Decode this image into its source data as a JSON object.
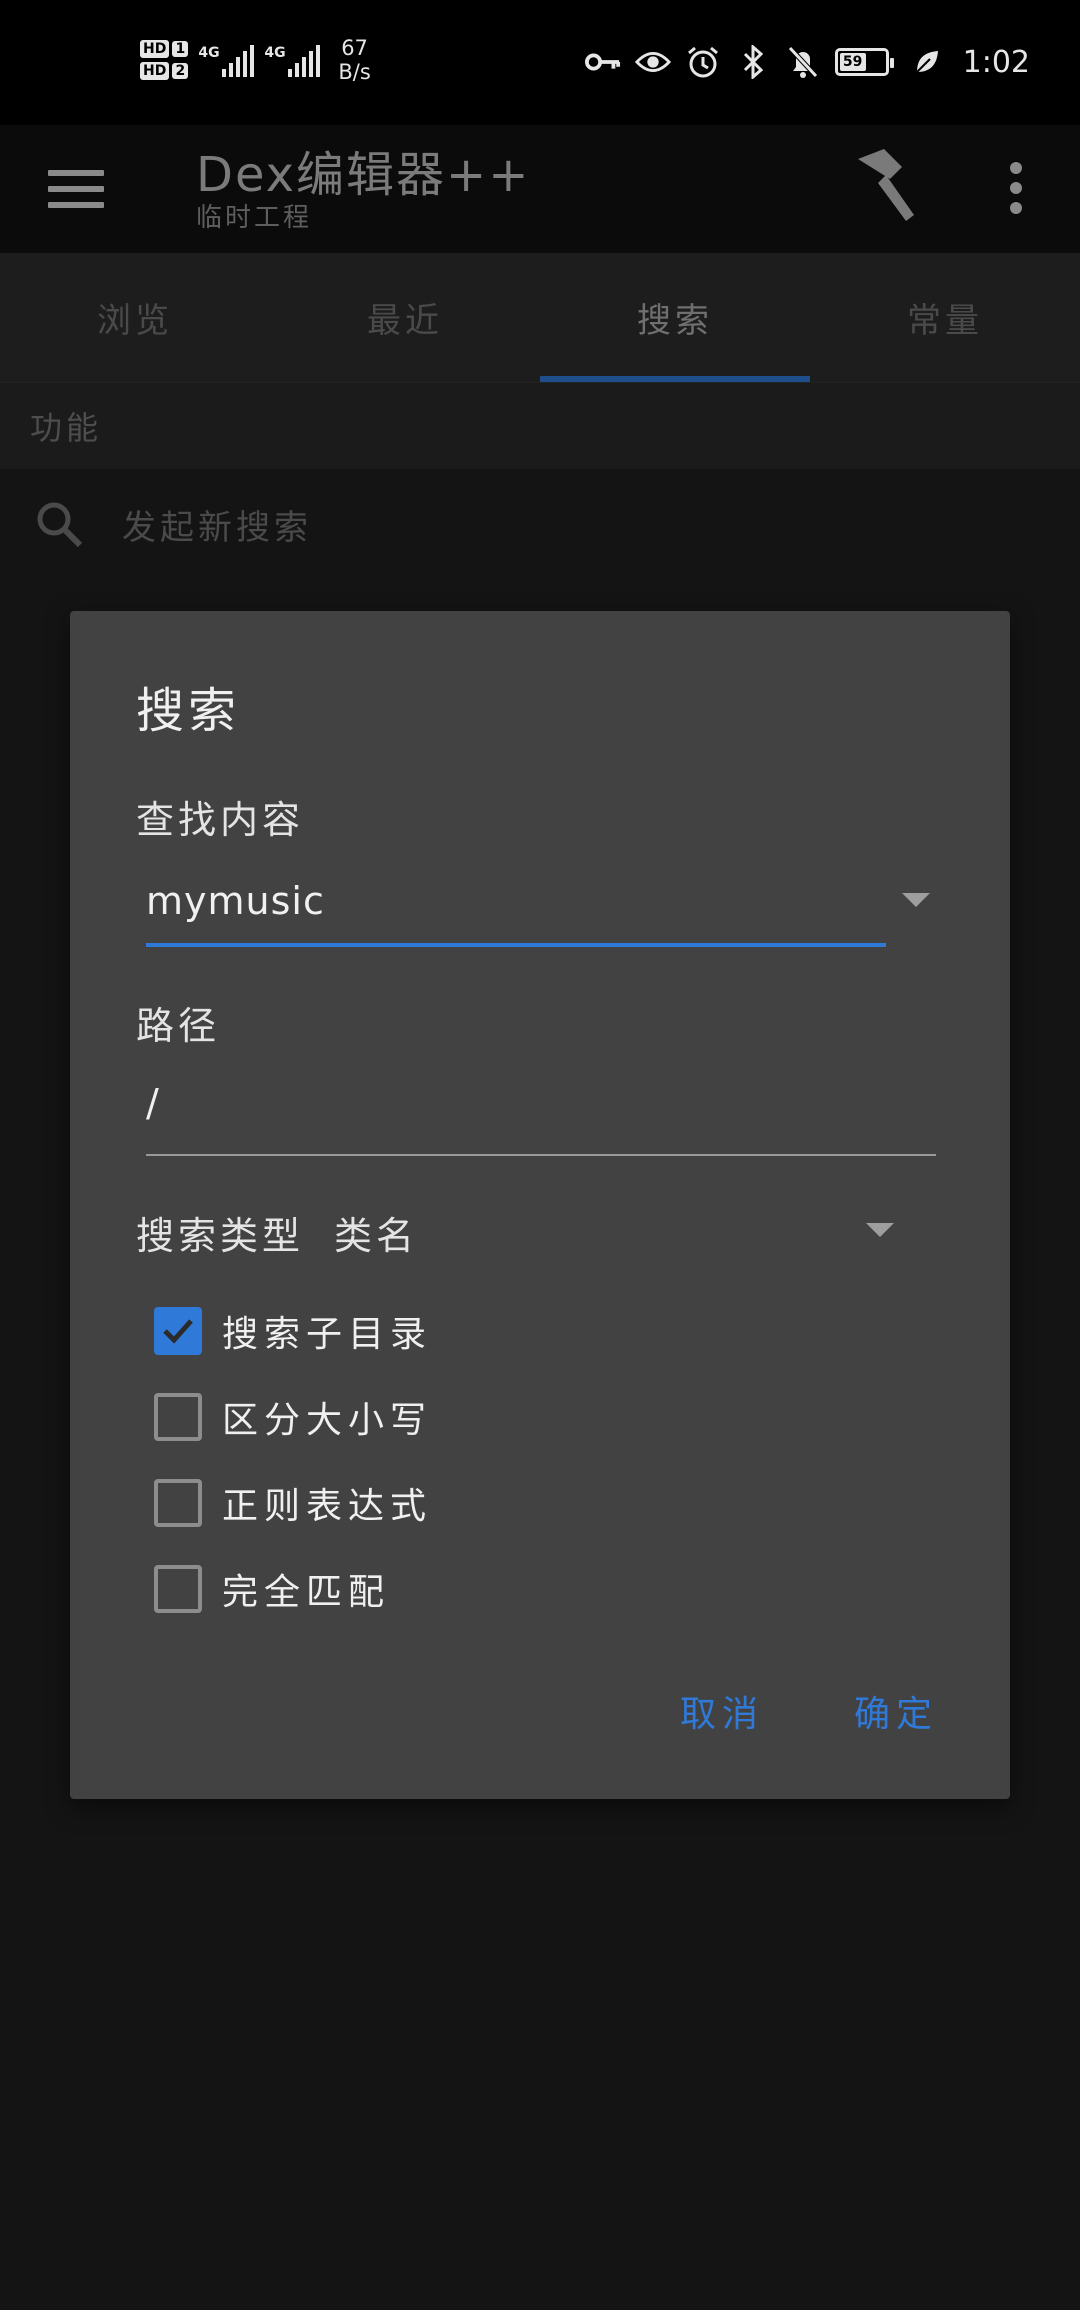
{
  "status_bar": {
    "hd1": "HD",
    "hd1_num": "1",
    "hd2": "HD",
    "hd2_num": "2",
    "net1": "4G",
    "net2": "4G",
    "speed_value": "67",
    "speed_unit": "B/s",
    "battery_level": "59",
    "time": "1:02",
    "icons": [
      "key-icon",
      "eye-icon",
      "alarm-icon",
      "bluetooth-icon",
      "bell-off-icon",
      "battery-icon",
      "leaf-icon"
    ]
  },
  "app_bar": {
    "title": "Dex编辑器++",
    "subtitle": "临时工程"
  },
  "tabs": [
    {
      "label": "浏览",
      "active": false
    },
    {
      "label": "最近",
      "active": false
    },
    {
      "label": "搜索",
      "active": true
    },
    {
      "label": "常量",
      "active": false
    }
  ],
  "section": {
    "header": "功能",
    "new_search": "发起新搜索"
  },
  "dialog": {
    "title": "搜索",
    "find_label": "查找内容",
    "find_value": "mymusic",
    "path_label": "路径",
    "path_value": "/",
    "search_type_label": "搜索类型",
    "search_type_value": "类名",
    "options": [
      {
        "label": "搜索子目录",
        "checked": true
      },
      {
        "label": "区分大小写",
        "checked": false
      },
      {
        "label": "正则表达式",
        "checked": false
      },
      {
        "label": "完全匹配",
        "checked": false
      }
    ],
    "cancel": "取消",
    "confirm": "确定"
  },
  "colors": {
    "accent": "#2f7ad9",
    "dialog_bg": "#424242",
    "background": "#141414"
  }
}
